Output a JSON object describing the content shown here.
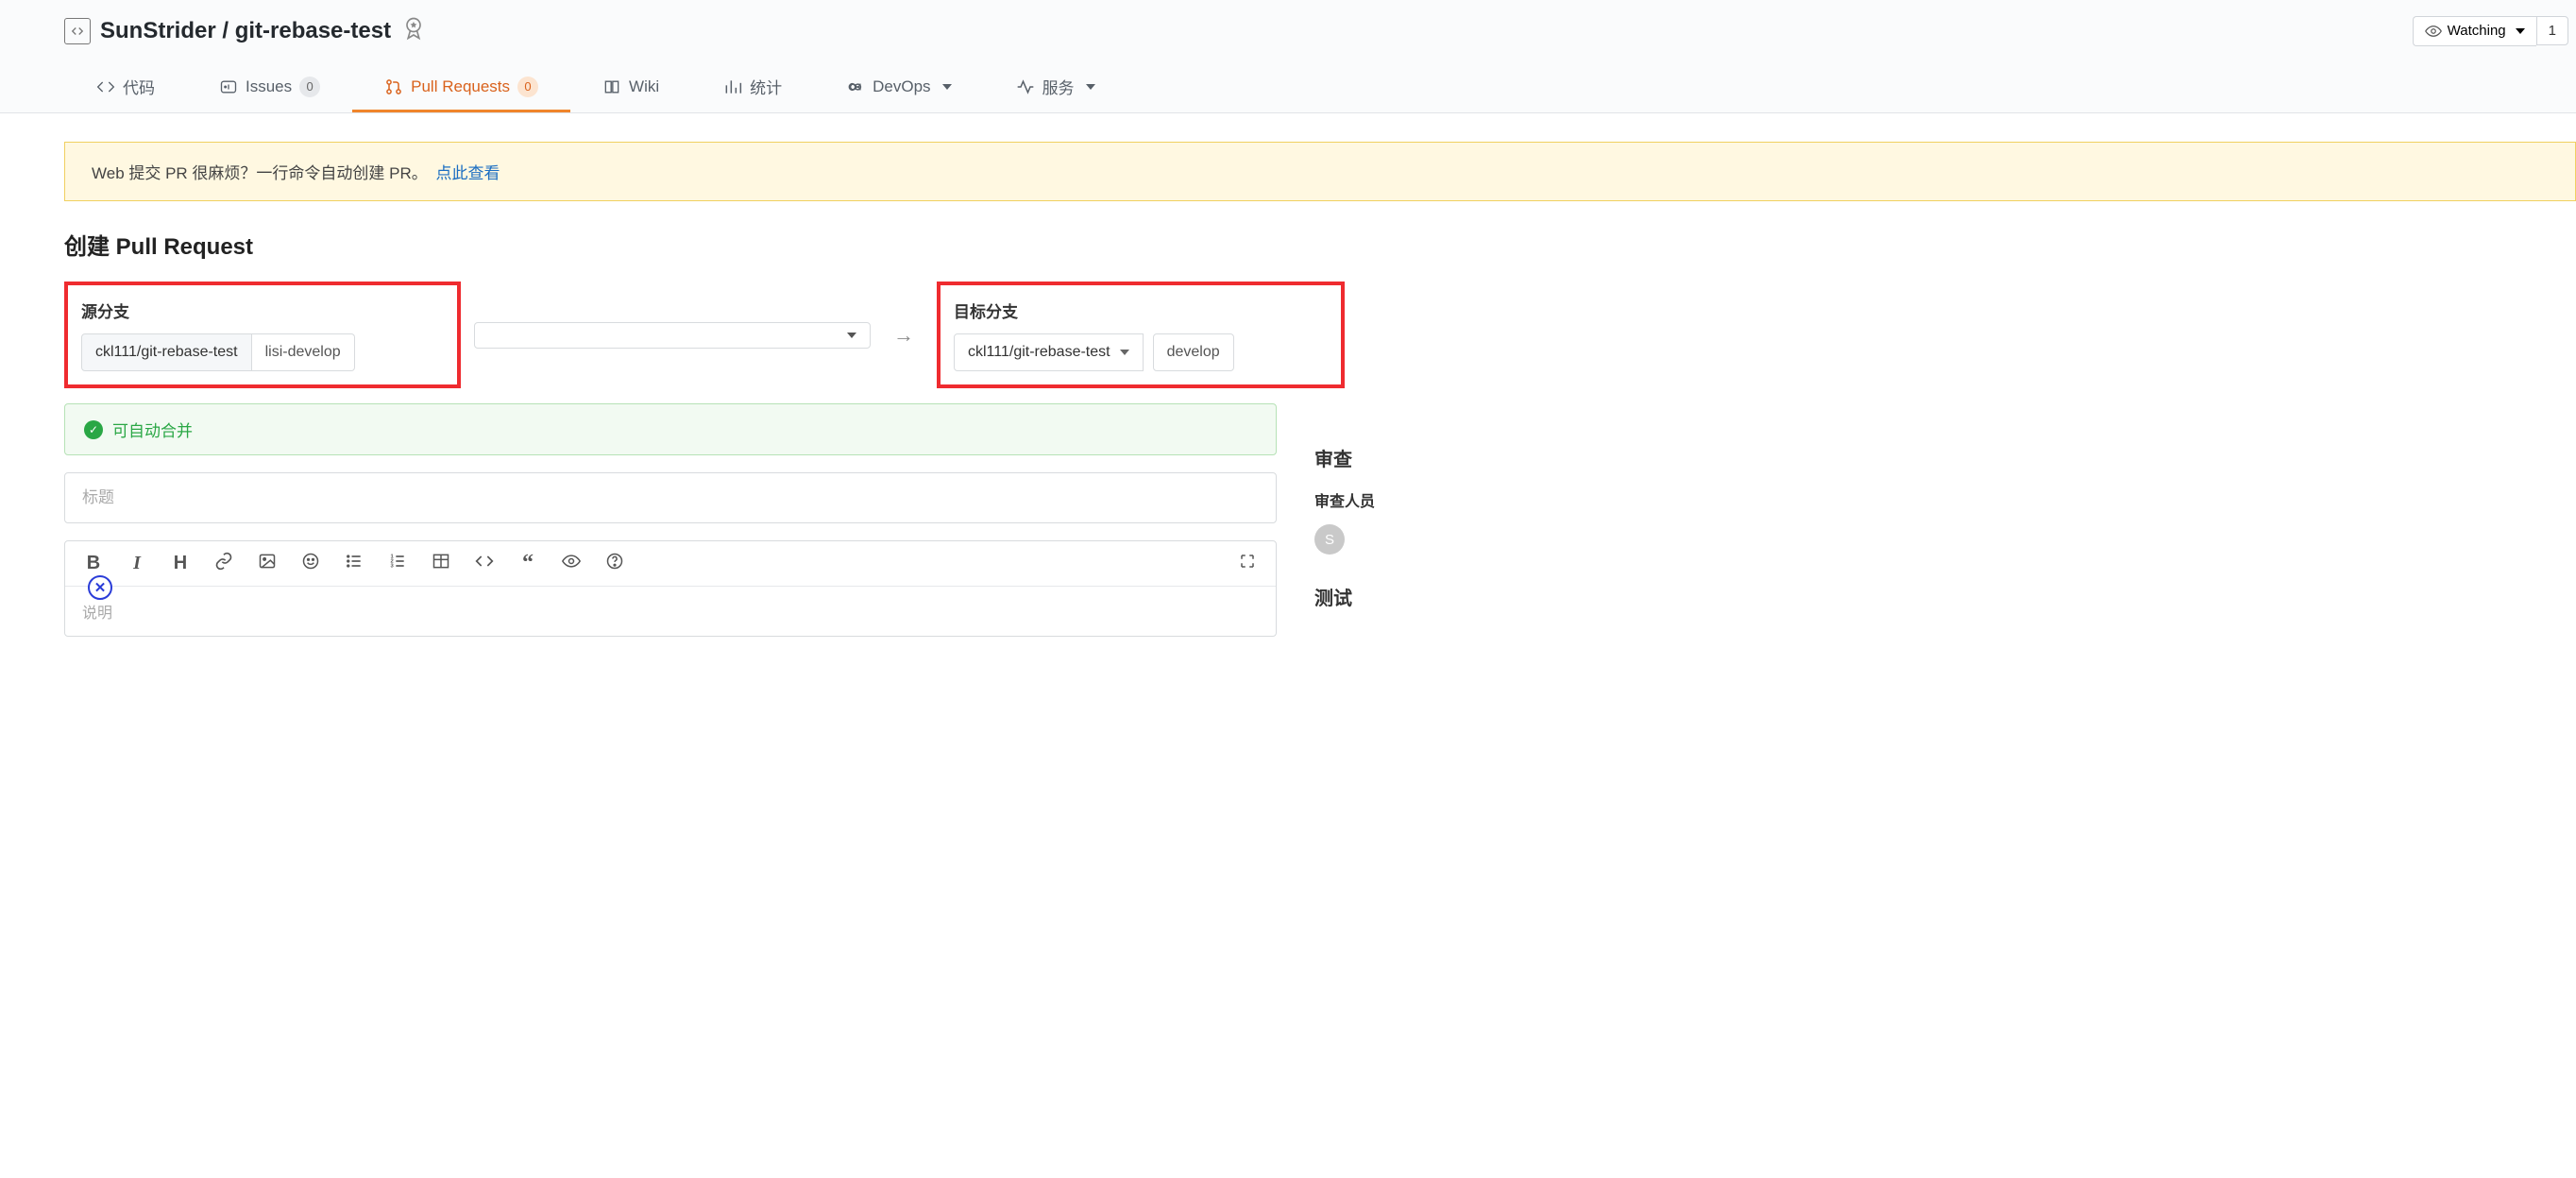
{
  "repo": {
    "owner": "SunStrider",
    "name": "git-rebase-test"
  },
  "watch": {
    "label": "Watching",
    "count": "1"
  },
  "tabs": {
    "code": "代码",
    "issues": "Issues",
    "issues_count": "0",
    "pulls": "Pull Requests",
    "pulls_count": "0",
    "wiki": "Wiki",
    "stats": "统计",
    "devops": "DevOps",
    "services": "服务"
  },
  "notice": {
    "text": "Web 提交 PR 很麻烦？一行命令自动创建 PR。",
    "link": "点此查看"
  },
  "page_title": "创建 Pull Request",
  "source": {
    "label": "源分支",
    "repo": "ckl111/git-rebase-test",
    "branch": "lisi-develop"
  },
  "target": {
    "label": "目标分支",
    "repo": "ckl111/git-rebase-test",
    "branch": "develop"
  },
  "merge_status": "可自动合并",
  "title_placeholder": "标题",
  "desc_placeholder": "说明",
  "sidebar": {
    "review": "审查",
    "reviewers": "审查人员",
    "avatar": "S",
    "test": "测试"
  }
}
